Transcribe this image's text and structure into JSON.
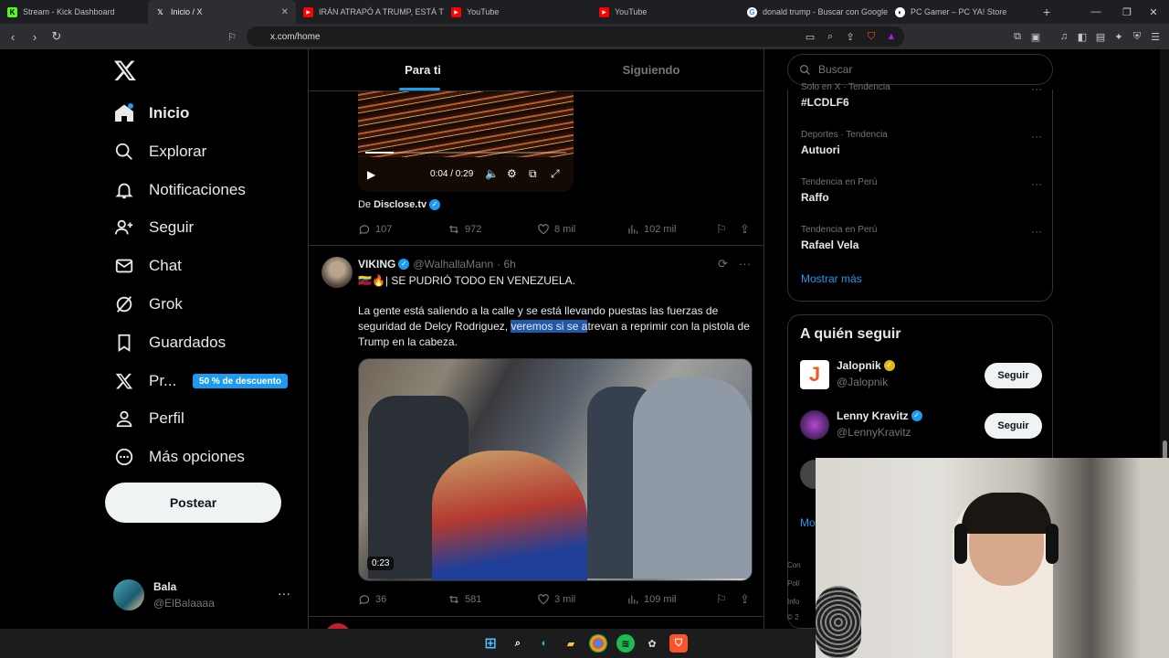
{
  "browser": {
    "tabs": [
      {
        "title": "Stream - Kick Dashboard",
        "fav_color": "#53fc18",
        "fav_glyph": "K"
      },
      {
        "title": "Inicio / X",
        "fav_color": "#000000",
        "fav_glyph": "𝕏",
        "active": true
      },
      {
        "title": "IRÁN ATRAPÓ A TRUMP, ESTÁ TOTAL",
        "fav_color": "#ff0000",
        "fav_glyph": "▶"
      },
      {
        "title": "YouTube",
        "fav_color": "#ff0000",
        "fav_glyph": "▶"
      },
      {
        "title": "YouTube",
        "fav_color": "#ff0000",
        "fav_glyph": "▶"
      },
      {
        "title": "donald trump - Buscar con Google",
        "fav_color": "#ffffff",
        "fav_glyph": "G"
      },
      {
        "title": "PC Gamer – PC YA! Store",
        "fav_color": "#ffffff",
        "fav_glyph": "◐"
      }
    ],
    "new_tab": "+",
    "url": "x.com/home"
  },
  "nav": {
    "items": [
      {
        "label": "Inicio",
        "icon": "home-icon"
      },
      {
        "label": "Explorar",
        "icon": "search-icon"
      },
      {
        "label": "Notificaciones",
        "icon": "bell-icon"
      },
      {
        "label": "Seguir",
        "icon": "follow-icon"
      },
      {
        "label": "Chat",
        "icon": "mail-icon"
      },
      {
        "label": "Grok",
        "icon": "grok-icon"
      },
      {
        "label": "Guardados",
        "icon": "bookmark-icon"
      },
      {
        "label": "Pr...",
        "icon": "x-icon"
      },
      {
        "label": "Perfil",
        "icon": "person-icon"
      },
      {
        "label": "Más opciones",
        "icon": "more-circle-icon"
      }
    ],
    "promo_badge": "50 % de descuento",
    "post_button": "Postear",
    "profile": {
      "name": "Bala",
      "handle": "@ElBalaaaa"
    }
  },
  "timeline": {
    "tabs": [
      "Para ti",
      "Siguiendo"
    ],
    "first_post": {
      "video_time": "0:04 / 0:29",
      "progress": 0.14,
      "source_prefix": "De",
      "source": "Disclose.tv",
      "replies": "107",
      "reposts": "972",
      "likes": "8 mil",
      "views": "102 mil"
    },
    "second_post": {
      "author": "VIKING",
      "handle": "@WalhallaMann",
      "time": "· 6h",
      "headline": "🇻🇪🔥| SE PUDRIÓ TODO EN VENEZUELA.",
      "body_before": "La gente está saliendo a la calle y se está llevando puestas las fuerzas de seguridad de Delcy Rodriguez, ",
      "body_selected": "veremos si se a",
      "body_after": "trevan a reprimir con la pistola de Trump en la cabeza.",
      "video_duration": "0:23",
      "replies": "36",
      "reposts": "581",
      "likes": "3 mil",
      "views": "109 mil"
    }
  },
  "sidebar": {
    "search_placeholder": "Buscar",
    "trends": [
      {
        "category": "Solo en X · Tendencia",
        "title": "#LCDLF6"
      },
      {
        "category": "Deportes · Tendencia",
        "title": "Autuori"
      },
      {
        "category": "Tendencia en Perú",
        "title": "Raffo"
      },
      {
        "category": "Tendencia en Perú",
        "title": "Rafael Vela"
      }
    ],
    "show_more": "Mostrar más",
    "who_to_follow_title": "A quién seguir",
    "follow": [
      {
        "name": "Jalopnik",
        "handle": "@Jalopnik",
        "badge": "gold",
        "button": "Seguir"
      },
      {
        "name": "Lenny Kravitz",
        "handle": "@LennyKravitz",
        "badge": "blue",
        "button": "Seguir"
      }
    ],
    "more_partial": "Mo",
    "footer_partial": [
      "Con",
      "Polí",
      "Info",
      "© 2"
    ]
  },
  "colors": {
    "accent": "#1d9bf0",
    "background": "#000000",
    "muted": "#71767b",
    "gold": "#e2b719"
  }
}
